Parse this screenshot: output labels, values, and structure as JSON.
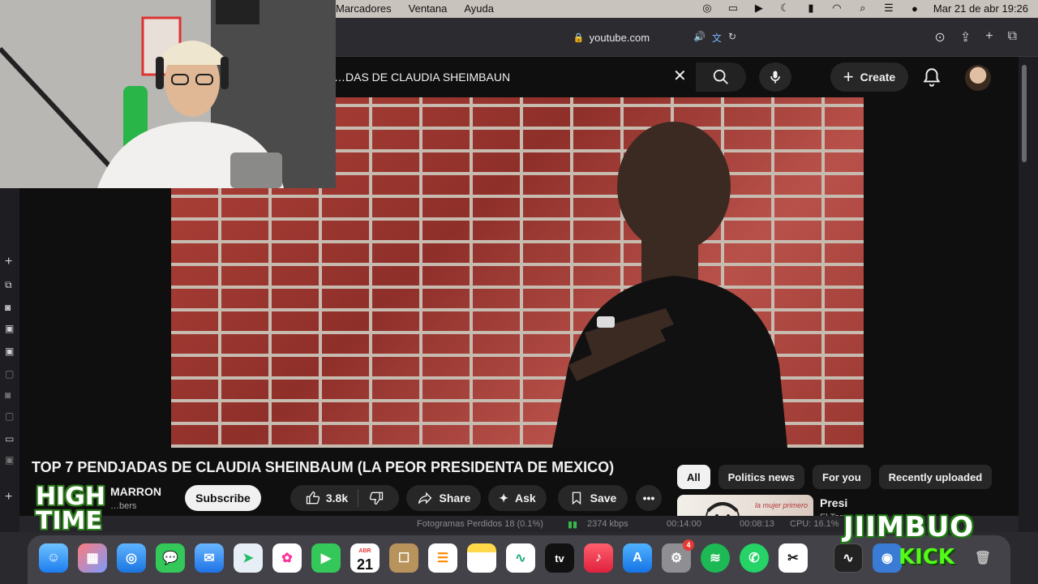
{
  "menubar": {
    "menus": [
      "Marcadores",
      "Ventana",
      "Ayuda"
    ],
    "datetime": "Mar 21 de abr  19:26"
  },
  "browser": {
    "url": "youtube.com"
  },
  "youtube": {
    "search_query": "…DAS DE CLAUDIA SHEIMBAUN",
    "create_label": "Create",
    "video_title": "TOP 7 PENDJADAS DE CLAUDIA SHEINBAUM (LA PEOR PRESIDENTA DE MEXICO)",
    "channel_name": "MARRON",
    "subscriber_text": "…bers",
    "subscribe_label": "Subscribe",
    "like_count": "3.8k",
    "share_label": "Share",
    "ask_label": "Ask",
    "save_label": "Save",
    "chips": [
      "All",
      "Politics news",
      "For you",
      "Recently uploaded"
    ],
    "recommended": {
      "title": "Presi",
      "channel": "El Torn",
      "thumb_text": "la mujer primero"
    }
  },
  "obs_status": {
    "dropped": "Fotogramas Perdidos 18 (0.1%)",
    "bitrate": "2374 kbps",
    "time1": "00:14:00",
    "time2": "00:08:13",
    "cpu": "CPU: 16.1%"
  },
  "dock": {
    "calendar_month": "ABR",
    "calendar_day": "21",
    "tv_label": "tv",
    "settings_badge": "4"
  },
  "overlays": {
    "hightime_line1": "HIGH",
    "hightime_line2": "TIME",
    "jimbuo": "JIIMBUO",
    "kick": "KICK"
  }
}
